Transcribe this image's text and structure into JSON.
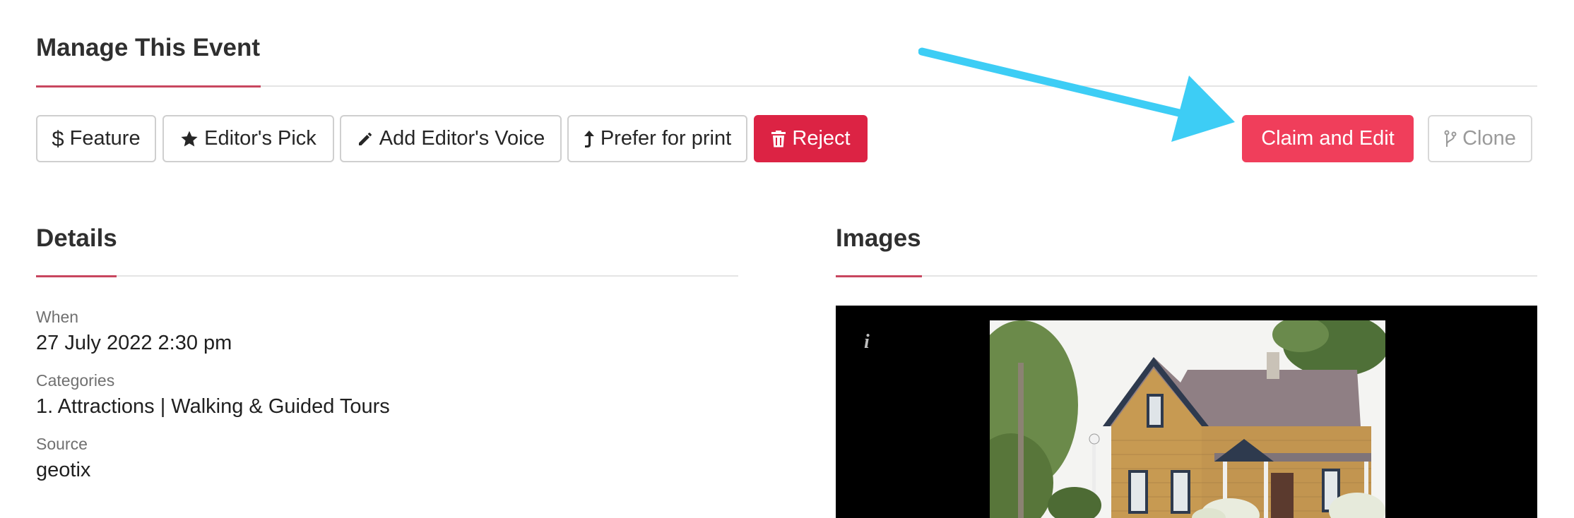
{
  "manage": {
    "title": "Manage This Event"
  },
  "actions": {
    "feature": "Feature",
    "editors_pick": "Editor's Pick",
    "add_voice": "Add Editor's Voice",
    "prefer_print": "Prefer for print",
    "reject": "Reject",
    "claim_edit": "Claim and Edit",
    "clone": "Clone"
  },
  "details": {
    "title": "Details",
    "fields": [
      {
        "label": "When",
        "value": "27 July 2022 2:30 pm"
      },
      {
        "label": "Categories",
        "value": "1. Attractions | Walking & Guided Tours"
      },
      {
        "label": "Source",
        "value": "geotix"
      }
    ]
  },
  "images": {
    "title": "Images",
    "info_icon": "i"
  },
  "colors": {
    "accent": "#c8465f",
    "reject": "#dc2344",
    "claim": "#f03e5b",
    "arrow": "#3dcdf5"
  },
  "icons": [
    "dollar-icon",
    "star-icon",
    "pencil-icon",
    "arrow-up-icon",
    "trash-icon",
    "fork-icon",
    "info-icon"
  ]
}
